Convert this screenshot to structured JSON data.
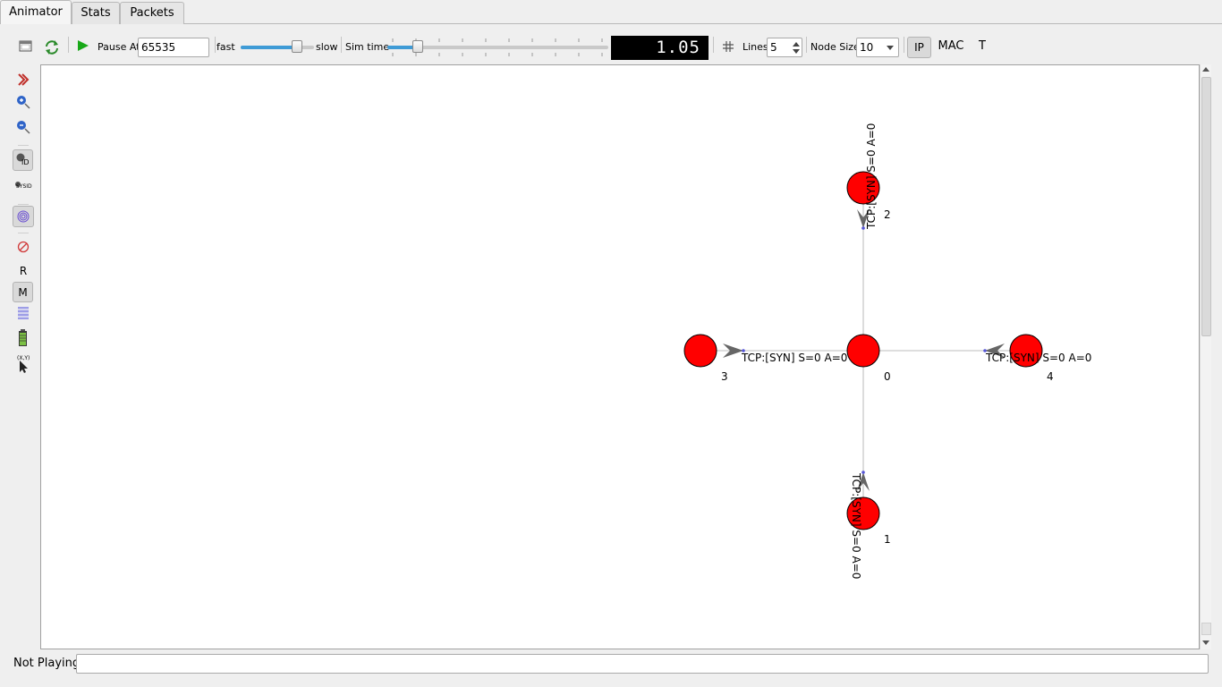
{
  "tabs": [
    {
      "label": "Animator",
      "active": true
    },
    {
      "label": "Stats",
      "active": false
    },
    {
      "label": "Packets",
      "active": false
    }
  ],
  "toolbar": {
    "pause_at_label": "Pause At",
    "pause_at_value": "65535",
    "speed_fast_label": "fast",
    "speed_slow_label": "slow",
    "speed_level": 0.82,
    "sim_time_label": "Sim time",
    "sim_time_level": 0.12,
    "sim_time_display": "1.05",
    "lines_label": "Lines",
    "lines_value": "5",
    "node_size_label": "Node Size",
    "node_size_value": "10",
    "ip_label": "IP",
    "mac_label": "MAC",
    "t_label": "T",
    "icons": [
      "open-file-icon",
      "reload-icon",
      "play-icon",
      "grid-icon"
    ]
  },
  "side_toolbar": {
    "r_label": "R",
    "m_label": "M",
    "xy_label": "(X,Y)",
    "id_label": "ID",
    "sysid_label": "SYSID",
    "icons": [
      "expand-chevron-icon",
      "zoom-in-icon",
      "zoom-out-icon",
      "show-node-id-icon",
      "show-sysid-icon",
      "fingerprint-icon",
      "blocked-icon",
      "routing-r-icon",
      "mac-m-icon",
      "packet-list-icon",
      "battery-icon",
      "mouse-position-icon"
    ]
  },
  "topology": {
    "node_color": "#ff0000",
    "nodes": [
      {
        "id": "0",
        "label": "0"
      },
      {
        "id": "1",
        "label": "1"
      },
      {
        "id": "2",
        "label": "2"
      },
      {
        "id": "3",
        "label": "3"
      },
      {
        "id": "4",
        "label": "4"
      }
    ],
    "packets": [
      {
        "to": "3",
        "text": "TCP:[SYN] S=0 A=0"
      },
      {
        "to": "4",
        "text": "TCP:[SYN] S=0 A=0"
      },
      {
        "to": "2",
        "text": "TCP:[SYN] S=0 A=0"
      },
      {
        "to": "1",
        "text": "TCP:[SYN] S=0 A=0"
      }
    ]
  },
  "status": {
    "text": "Not Playing",
    "box_value": ""
  }
}
